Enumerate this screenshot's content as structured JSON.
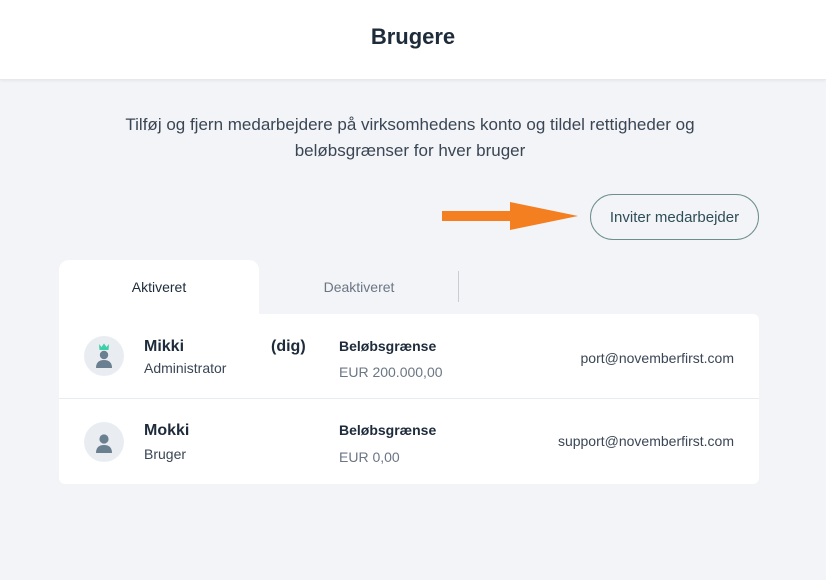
{
  "header": {
    "title": "Brugere"
  },
  "description": "Tilføj og fjern medarbejdere på virksomhedens konto og tildel rettigheder og beløbsgrænser for hver bruger",
  "actions": {
    "invite_label": "Inviter medarbejder"
  },
  "tabs": [
    {
      "label": "Aktiveret",
      "active": true
    },
    {
      "label": "Deaktiveret",
      "active": false
    }
  ],
  "users": [
    {
      "name": "Mikki",
      "you_tag": "(dig)",
      "role": "Administrator",
      "limit_label": "Beløbsgrænse",
      "limit_value": "EUR 200.000,00",
      "email": "port@novemberfirst.com",
      "icon": "admin-user-icon"
    },
    {
      "name": "Mokki",
      "role": "Bruger",
      "limit_label": "Beløbsgrænse",
      "limit_value": "EUR 0,00",
      "email": "support@novemberfirst.com",
      "icon": "user-icon"
    }
  ],
  "colors": {
    "arrow": "#f47f20",
    "crown": "#3ccfa9",
    "accent_border": "#6c8f8d",
    "background": "#f3f4f7"
  }
}
